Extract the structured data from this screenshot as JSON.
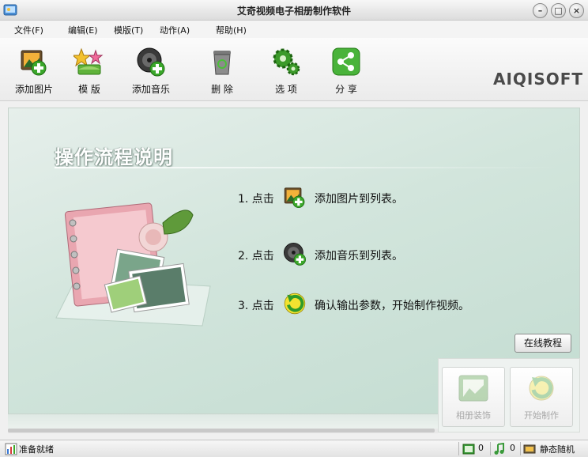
{
  "window": {
    "title": "艾奇视频电子相册制作软件"
  },
  "menu": [
    {
      "label": "文件(F)"
    },
    {
      "label": "编辑(E)"
    },
    {
      "label": "模版(T)"
    },
    {
      "label": "动作(A)"
    },
    {
      "label": "帮助(H)"
    }
  ],
  "toolbar": {
    "add_image": "添加图片",
    "template": "模 版",
    "add_music": "添加音乐",
    "delete": "删 除",
    "options": "选 项",
    "share": "分 享",
    "brand": "AIQISOFT"
  },
  "panel": {
    "title": "操作流程说明",
    "steps": [
      {
        "num": "1. 点击",
        "icon": "add-image-icon",
        "text": "添加图片到列表。"
      },
      {
        "num": "2. 点击",
        "icon": "add-music-icon",
        "text": "添加音乐到列表。"
      },
      {
        "num": "3. 点击",
        "icon": "start-make-icon",
        "text": "确认输出参数，开始制作视频。"
      }
    ],
    "online_tutorial": "在线教程"
  },
  "actions": {
    "album_decoration": "相册装饰",
    "start_make": "开始制作"
  },
  "status": {
    "text": "准备就绪",
    "image_count": "0",
    "music_count": "0",
    "mode": "静态随机"
  },
  "colors": {
    "panel_green": "#d2e5dc",
    "toolbar_green": "#3c9a2a",
    "disabled_text": "#a8a8a8"
  }
}
